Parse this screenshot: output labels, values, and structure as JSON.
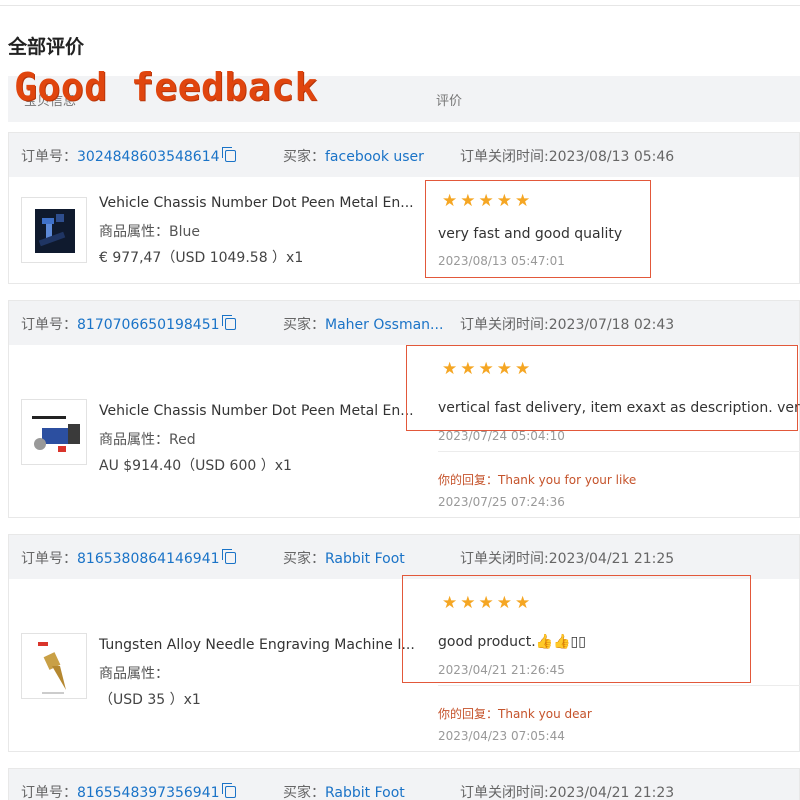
{
  "page": {
    "title": "全部评价",
    "overlay_title": "Good feedback",
    "header_col1": "宝贝信息",
    "header_col2": "评价"
  },
  "orders": [
    {
      "order_label": "订单号：",
      "order_no": "3024848603548614",
      "buyer_label": "买家：",
      "buyer": "facebook user",
      "close_time": "订单关闭时间:2023/08/13 05:46",
      "product_name": "Vehicle Chassis Number Dot Peen Metal En...",
      "attr": "商品属性：Blue",
      "price": "€ 977,47（USD  1049.58 ）x1",
      "stars": "★★★★★",
      "review": "very fast and good quality",
      "review_time": "2023/08/13 05:47:01"
    },
    {
      "order_label": "订单号：",
      "order_no": "8170706650198451",
      "buyer_label": "买家：",
      "buyer": "Maher Ossman...",
      "close_time": "订单关闭时间:2023/07/18 02:43",
      "product_name": "Vehicle Chassis Number Dot Peen Metal En...",
      "attr": "商品属性：Red",
      "price": "AU $914.40（USD  600 ）x1",
      "stars": "★★★★★",
      "review": "vertical fast delivery, item exaxt as description. very he",
      "review_time": "2023/07/24 05:04:10",
      "reply_label": "你的回复：",
      "reply": "Thank you for your like",
      "reply_time": "2023/07/25 07:24:36"
    },
    {
      "order_label": "订单号：",
      "order_no": "8165380864146941",
      "buyer_label": "买家：",
      "buyer": "Rabbit Foot",
      "close_time": "订单关闭时间:2023/04/21 21:25",
      "product_name": "Tungsten Alloy Needle Engraving Machine I...",
      "attr": "商品属性：",
      "price": "（USD  35 ）x1",
      "stars": "★★★★★",
      "review": "good product.👍👍▯▯",
      "review_time": "2023/04/21 21:26:45",
      "reply_label": "你的回复：",
      "reply": "Thank you dear",
      "reply_time": "2023/04/23 07:05:44"
    },
    {
      "order_label": "订单号：",
      "order_no": "8165548397356941",
      "buyer_label": "买家：",
      "buyer": "Rabbit Foot",
      "close_time": "订单关闭时间:2023/04/21 21:23"
    }
  ],
  "colors": {
    "link": "#1a73c7",
    "star": "#f5a623",
    "reply": "#c5532b",
    "highlight": "#e2583a",
    "overlay": "#e0450e"
  },
  "icons": {
    "copy": "copy-icon",
    "star": "star-icon"
  }
}
